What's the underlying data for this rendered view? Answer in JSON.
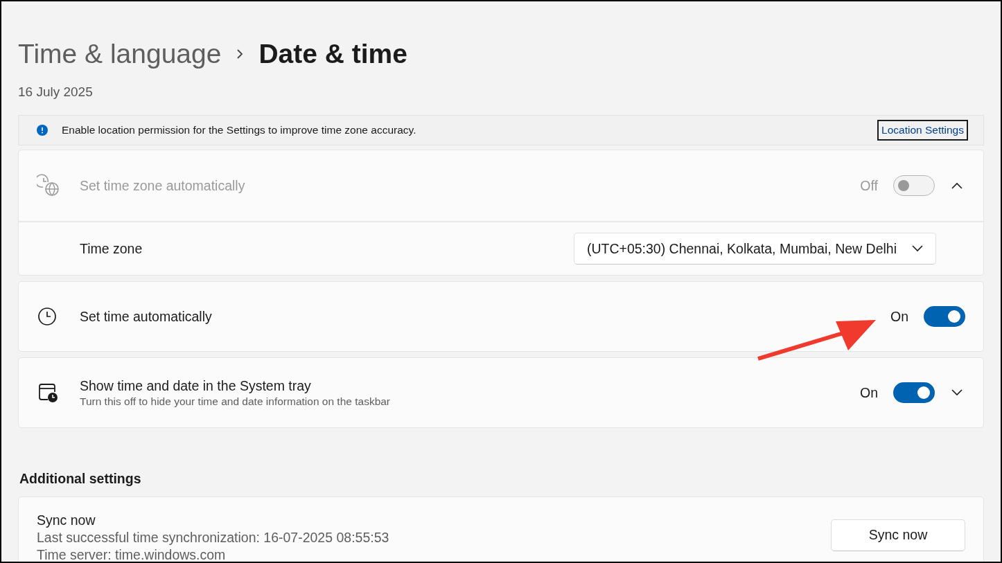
{
  "breadcrumb": {
    "parent": "Time & language",
    "current": "Date & time"
  },
  "date": "16 July 2025",
  "info_bar": {
    "message": "Enable location permission for the Settings to improve time zone accuracy.",
    "link": "Location Settings"
  },
  "cards": [
    {
      "kind": "toggle",
      "title": "Set time zone automatically",
      "disabled": true,
      "state_label": "Off",
      "on": false,
      "expanded": true,
      "children": [
        {
          "kind": "dropdown",
          "label": "Time zone",
          "value": "(UTC+05:30) Chennai, Kolkata, Mumbai, New Delhi"
        }
      ]
    },
    {
      "kind": "toggle",
      "title": "Set time automatically",
      "disabled": false,
      "state_label": "On",
      "on": true
    },
    {
      "kind": "toggle",
      "title": "Show time and date in the System tray",
      "subtitle": "Turn this off to hide your time and date information on the taskbar",
      "disabled": false,
      "state_label": "On",
      "on": true,
      "expanded": false
    }
  ],
  "additional": {
    "heading": "Additional settings",
    "sync": {
      "title": "Sync now",
      "lines": [
        "Last successful time synchronization: 16-07-2025 08:55:53",
        "Time server: time.windows.com"
      ],
      "button": "Sync now"
    }
  }
}
